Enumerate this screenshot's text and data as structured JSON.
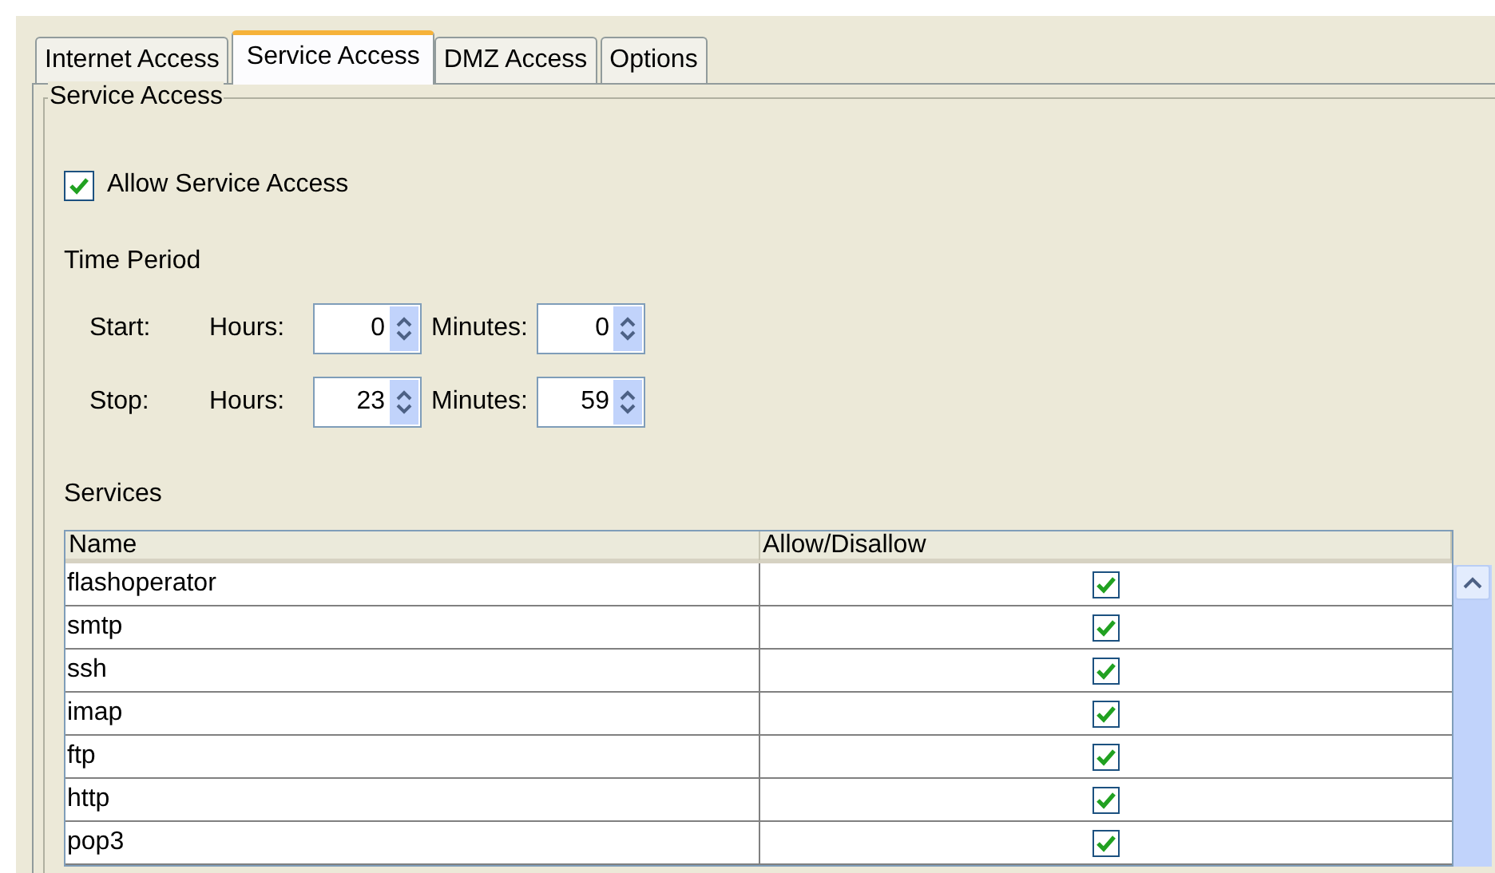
{
  "tabs": [
    {
      "label": "Internet Access",
      "selected": false
    },
    {
      "label": "Service Access",
      "selected": true
    },
    {
      "label": "DMZ Access",
      "selected": false
    },
    {
      "label": "Options",
      "selected": false
    }
  ],
  "group": {
    "title": "Service Access",
    "allow": {
      "label": "Allow Service Access",
      "checked": true
    },
    "time_period": {
      "label": "Time Period",
      "rows": [
        {
          "label": "Start:",
          "hours_label": "Hours:",
          "hours": "0",
          "minutes_label": "Minutes:",
          "minutes": "0"
        },
        {
          "label": "Stop:",
          "hours_label": "Hours:",
          "hours": "23",
          "minutes_label": "Minutes:",
          "minutes": "59"
        }
      ]
    },
    "services": {
      "label": "Services",
      "columns": [
        "Name",
        "Allow/Disallow"
      ],
      "rows": [
        {
          "name": "flashoperator",
          "allowed": true
        },
        {
          "name": "smtp",
          "allowed": true
        },
        {
          "name": "ssh",
          "allowed": true
        },
        {
          "name": "imap",
          "allowed": true
        },
        {
          "name": "ftp",
          "allowed": true
        },
        {
          "name": "http",
          "allowed": true
        },
        {
          "name": "pop3",
          "allowed": true
        }
      ]
    }
  }
}
